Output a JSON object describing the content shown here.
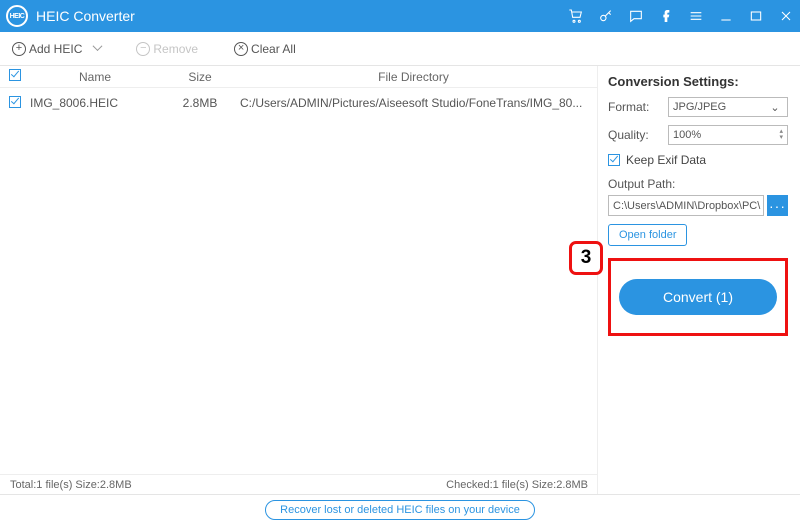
{
  "titlebar": {
    "app_name": "HEIC Converter"
  },
  "toolbar": {
    "add_label": "Add HEIC",
    "remove_label": "Remove",
    "clear_label": "Clear All"
  },
  "list": {
    "headers": {
      "name": "Name",
      "size": "Size",
      "dir": "File Directory"
    },
    "items": [
      {
        "name": "IMG_8006.HEIC",
        "size": "2.8MB",
        "dir": "C:/Users/ADMIN/Pictures/Aiseesoft Studio/FoneTrans/IMG_80..."
      }
    ]
  },
  "settings": {
    "title": "Conversion Settings:",
    "format_label": "Format:",
    "format_value": "JPG/JPEG",
    "quality_label": "Quality:",
    "quality_value": "100%",
    "keep_exif_label": "Keep Exif Data",
    "output_label": "Output Path:",
    "output_value": "C:\\Users\\ADMIN\\Dropbox\\PC\\",
    "open_folder_label": "Open folder",
    "convert_label": "Convert (1)"
  },
  "callout": {
    "number": "3"
  },
  "status": {
    "total": "Total:1 file(s) Size:2.8MB",
    "checked": "Checked:1 file(s) Size:2.8MB"
  },
  "bottom_link": "Recover lost or deleted HEIC files on your device"
}
